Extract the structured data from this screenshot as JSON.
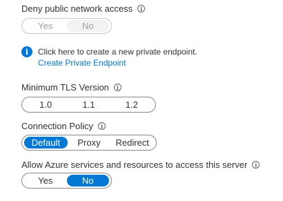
{
  "deny_public_network_access": {
    "label": "Deny public network access",
    "info_icon": "info-outline-icon",
    "options": [
      "Yes",
      "No"
    ],
    "selected": "No",
    "disabled": true
  },
  "private_endpoint_notice": {
    "icon": "info-filled-icon",
    "message": "Click here to create a new private endpoint.",
    "link_text": "Create Private Endpoint"
  },
  "minimum_tls_version": {
    "label": "Minimum TLS Version",
    "info_icon": "info-outline-icon",
    "options": [
      "1.0",
      "1.1",
      "1.2"
    ]
  },
  "connection_policy": {
    "label": "Connection Policy",
    "info_icon": "info-outline-icon",
    "options": [
      "Default",
      "Proxy",
      "Redirect"
    ],
    "selected": "Default"
  },
  "allow_azure_services": {
    "label": "Allow Azure services and resources to access this server",
    "info_icon": "info-outline-icon",
    "options": [
      "Yes",
      "No"
    ],
    "selected": "No"
  },
  "colors": {
    "accent": "#0078d4",
    "text": "#323130",
    "disabled_text": "#a19f9d",
    "border": "#8a8886"
  }
}
